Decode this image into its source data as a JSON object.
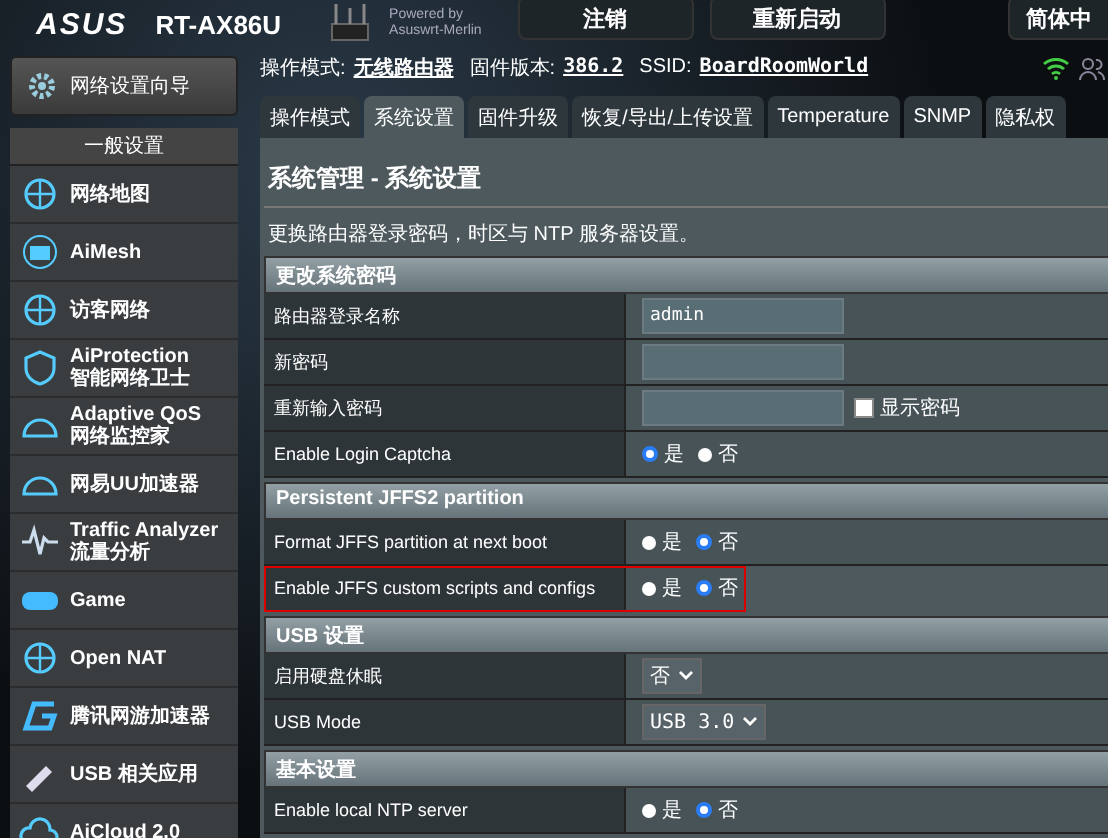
{
  "header": {
    "brand": "ASUS",
    "model": "RT-AX86U",
    "powered_by": "Powered by",
    "firmware_name": "Asuswrt-Merlin",
    "buttons": [
      "注销",
      "重新启动"
    ],
    "language": "简体中"
  },
  "info": [
    {
      "label": "操作模式:",
      "value": "无线路由器"
    },
    {
      "label": "固件版本:",
      "value": "386.2"
    },
    {
      "label": "SSID:",
      "value": "BoardRoomWorld"
    }
  ],
  "sidebar": {
    "wizard": "网络设置向导",
    "section": "一般设置",
    "items": [
      {
        "label": "网络地图"
      },
      {
        "label": "AiMesh"
      },
      {
        "label": "访客网络"
      },
      {
        "label": "AiProtection",
        "sub": "智能网络卫士"
      },
      {
        "label": "Adaptive QoS",
        "sub": "网络监控家"
      },
      {
        "label": "网易UU加速器"
      },
      {
        "label": "Traffic Analyzer",
        "sub": "流量分析"
      },
      {
        "label": "Game"
      },
      {
        "label": "Open NAT"
      },
      {
        "label": "腾讯网游加速器"
      },
      {
        "label": "USB 相关应用"
      },
      {
        "label": "AiCloud 2.0"
      }
    ]
  },
  "tabs": [
    {
      "label": "操作模式",
      "selected": false
    },
    {
      "label": "系统设置",
      "selected": true
    },
    {
      "label": "固件升级",
      "selected": false
    },
    {
      "label": "恢复/导出/上传设置",
      "selected": false
    },
    {
      "label": "Temperature",
      "selected": false
    },
    {
      "label": "SNMP",
      "selected": false
    },
    {
      "label": "隐私权",
      "selected": false
    }
  ],
  "page": {
    "title": "系统管理 - 系统设置",
    "description": "更换路由器登录密码，时区与 NTP 服务器设置。"
  },
  "sections": [
    {
      "title": "更改系统密码",
      "rows": [
        {
          "label": "路由器登录名称",
          "kind": "text",
          "value": "admin",
          "highlighted": false
        },
        {
          "label": "新密码",
          "kind": "text",
          "value": "",
          "highlighted": false
        },
        {
          "label": "重新输入密码",
          "kind": "password",
          "value": "",
          "checkbox_label": "显示密码",
          "checked": false,
          "highlighted": false
        },
        {
          "label": "Enable Login Captcha",
          "kind": "radio",
          "options": [
            {
              "label": "是",
              "selected": true
            },
            {
              "label": "否",
              "selected": false
            }
          ],
          "highlighted": false
        }
      ]
    },
    {
      "title": "Persistent JFFS2 partition",
      "rows": [
        {
          "label": "Format JFFS partition at next boot",
          "kind": "radio",
          "options": [
            {
              "label": "是",
              "selected": false
            },
            {
              "label": "否",
              "selected": true
            }
          ],
          "highlighted": false
        },
        {
          "label": "Enable JFFS custom scripts and configs",
          "kind": "radio",
          "options": [
            {
              "label": "是",
              "selected": false
            },
            {
              "label": "否",
              "selected": true
            }
          ],
          "highlighted": true
        }
      ]
    },
    {
      "title": "USB 设置",
      "rows": [
        {
          "label": "启用硬盘休眠",
          "kind": "select",
          "value": "否",
          "highlighted": false
        },
        {
          "label": "USB Mode",
          "kind": "select",
          "value": "USB 3.0",
          "highlighted": false
        }
      ]
    },
    {
      "title": "基本设置",
      "rows": [
        {
          "label": "Enable local NTP server",
          "kind": "radio",
          "options": [
            {
              "label": "是",
              "selected": false
            },
            {
              "label": "否",
              "selected": true
            }
          ],
          "highlighted": false
        }
      ]
    }
  ]
}
